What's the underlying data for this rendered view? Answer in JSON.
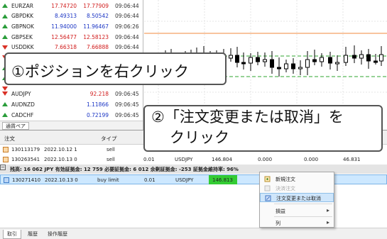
{
  "market_watch": {
    "rows": [
      {
        "symbol": "EURZAR",
        "bid": "17.74720",
        "ask": "17.77909",
        "time": "09:06:44",
        "dir": "up"
      },
      {
        "symbol": "GBPDKK",
        "bid": "8.49313",
        "ask": "8.50542",
        "time": "09:06:44",
        "dir": "up"
      },
      {
        "symbol": "GBPNOK",
        "bid": "11.94000",
        "ask": "11.96467",
        "time": "09:06:26",
        "dir": "up"
      },
      {
        "symbol": "GBPSEK",
        "bid": "12.56477",
        "ask": "12.58123",
        "time": "09:06:44",
        "dir": "up"
      },
      {
        "symbol": "USDDKK",
        "bid": "7.66318",
        "ask": "7.66888",
        "time": "09:06:44",
        "dir": "down"
      },
      {
        "symbol": "AUDJPY",
        "bid": "",
        "ask": "92.218",
        "time": "09:06:45",
        "dir": "down"
      },
      {
        "symbol": "AUDNZD",
        "bid": "",
        "ask": "1.11866",
        "time": "09:06:45",
        "dir": "up"
      },
      {
        "symbol": "CADCHF",
        "bid": "",
        "ask": "0.72199",
        "time": "09:06:45",
        "dir": "up"
      }
    ],
    "tab": "通貨ペア"
  },
  "terminal": {
    "headers": {
      "order": "注文",
      "type": "タイプ"
    },
    "rows": [
      {
        "order": "130113179",
        "time": "2022.10.12 1",
        "type": "sell",
        "volume": "",
        "symbol": "",
        "price": "",
        "sl": "",
        "tp": "",
        "cur": ""
      },
      {
        "order": "130263541",
        "time": "2022.10.13 0",
        "type": "sell",
        "volume": "0.01",
        "symbol": "USDJPY",
        "price": "146.804",
        "sl": "0.000",
        "tp": "0.000",
        "cur": "46.831"
      }
    ],
    "summary": "残高: 16 062 JPY  有効証拠金: 12 759  必要証拠金: 6 012  余剰証拠金: -253  証拠金維持率: 96%",
    "selected_row": {
      "order": "130271410",
      "time": "2022.10.13 0",
      "type": "buy limit",
      "volume": "0.01",
      "symbol": "USDJPY",
      "price": "146.813",
      "sl": "0.000",
      "tp": "0.000",
      "cur": "46.831"
    },
    "tabs": [
      "取引",
      "履歴",
      "操作履歴"
    ]
  },
  "context_menu": {
    "items": [
      {
        "label": "新規注文",
        "disabled": false
      },
      {
        "label": "決済注文",
        "disabled": true
      },
      {
        "label": "注文変更または取消",
        "disabled": false,
        "highlighted": true
      },
      {
        "label": "損益",
        "submenu": true
      },
      {
        "label": "列",
        "submenu": true
      }
    ]
  },
  "annotations": {
    "step1": "①ポジションを右クリック",
    "step2_line1": "②「注文変更または取消」を",
    "step2_line2": "クリック"
  },
  "colors": {
    "selected_price_bg": "#33cc33",
    "selected_row_bg": "#cde8ff",
    "bid_red": "#d01a1a",
    "ask_blue": "#1b35c4"
  }
}
